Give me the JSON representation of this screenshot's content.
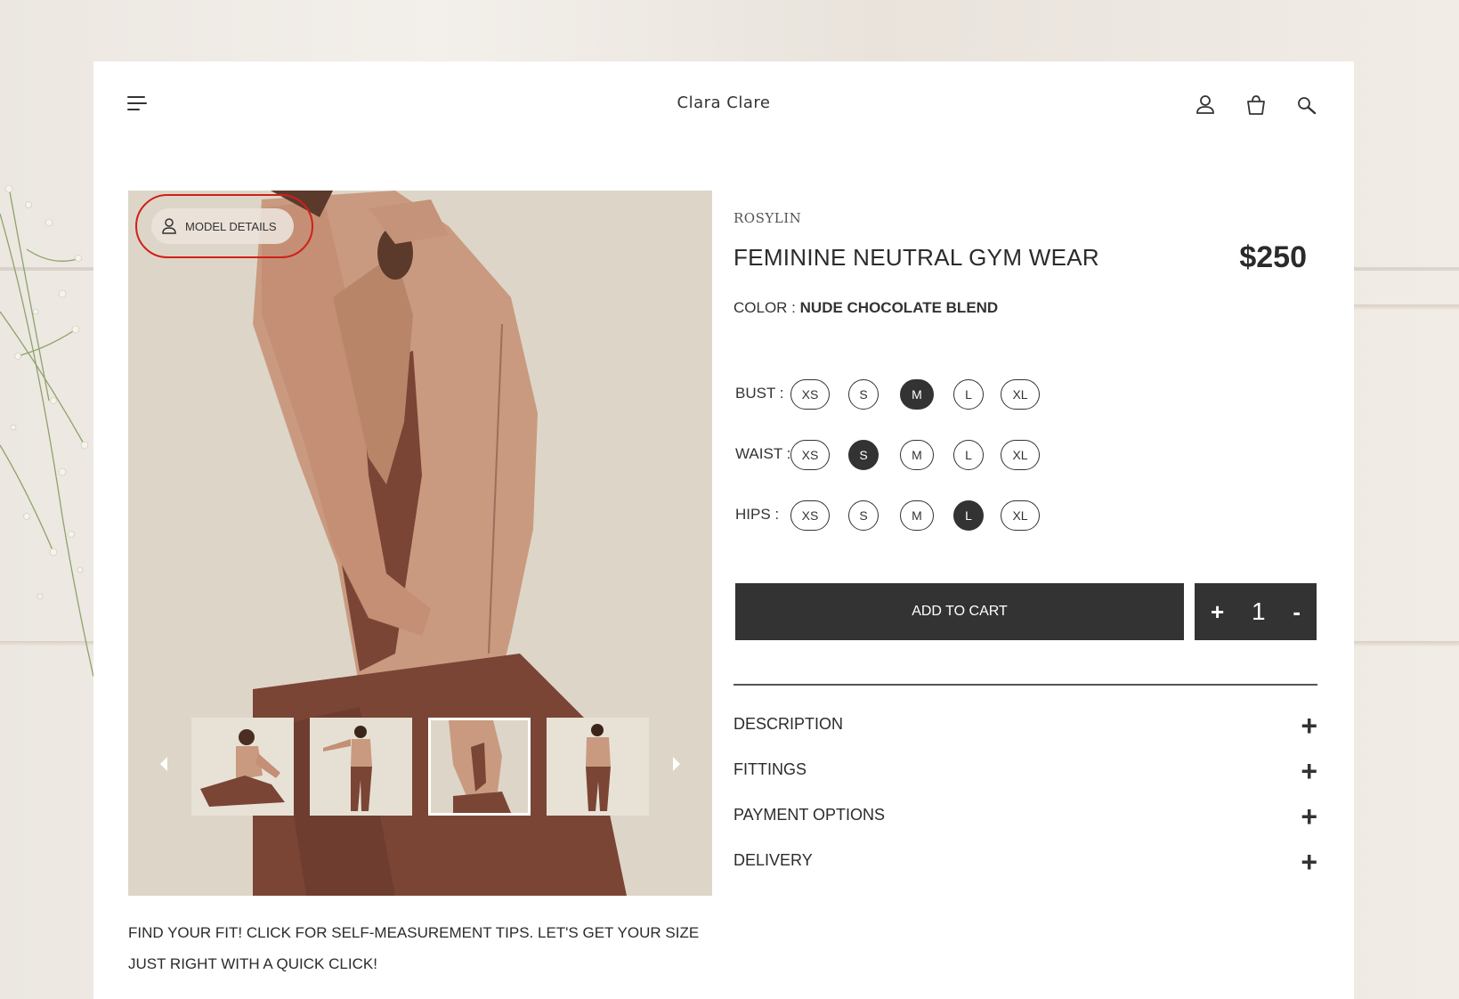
{
  "header": {
    "brand": "Clara Clare"
  },
  "image": {
    "model_details_label": "MODEL DETAILS",
    "thumbnails": [
      {
        "name": "thumb-seated"
      },
      {
        "name": "thumb-back-pose"
      },
      {
        "name": "thumb-side-closeup"
      },
      {
        "name": "thumb-back-full"
      }
    ],
    "active_thumbnail": 3
  },
  "fit_tips": {
    "line1": "FIND YOUR FIT! CLICK FOR SELF-MEASUREMENT TIPS. LET'S GET YOUR SIZE",
    "line2": "JUST RIGHT WITH A QUICK CLICK!"
  },
  "product": {
    "vendor": "ROSYLIN",
    "title": "FEMININE NEUTRAL GYM WEAR",
    "price": "$250",
    "color_label": "COLOR :",
    "color_value": "NUDE CHOCOLATE BLEND"
  },
  "sizes": {
    "options": [
      "XS",
      "S",
      "M",
      "L",
      "XL"
    ],
    "rows": [
      {
        "label": "BUST  :",
        "selected": "M"
      },
      {
        "label": "WAIST  :",
        "selected": "S"
      },
      {
        "label": "HIPS  :",
        "selected": "L"
      }
    ]
  },
  "cart": {
    "add_label": "ADD TO CART",
    "plus": "+",
    "quantity": "1",
    "minus": "-"
  },
  "accordion": [
    {
      "label": "DESCRIPTION",
      "icon": "+"
    },
    {
      "label": "FITTINGS",
      "icon": "+"
    },
    {
      "label": "PAYMENT OPTIONS",
      "icon": "+"
    },
    {
      "label": "DELIVERY",
      "icon": "+"
    }
  ],
  "colors": {
    "dark": "#333333",
    "highlight": "#d0201b",
    "jacket": "#c99a80",
    "legging": "#7a4535"
  }
}
